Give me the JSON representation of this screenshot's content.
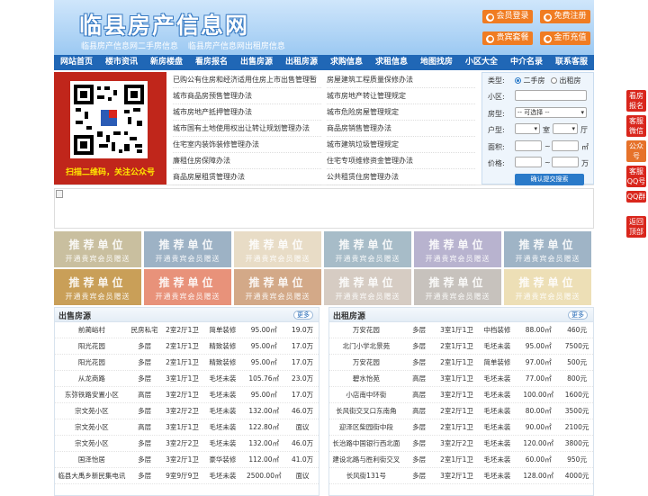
{
  "header": {
    "logo": "临县房产信息网",
    "sub_links": [
      "临县房产信息网二手房信息",
      "临县房产信息网出租房信息"
    ],
    "buttons": [
      {
        "label": "会员登录",
        "icon": "user-icon"
      },
      {
        "label": "免费注册",
        "icon": "register-icon"
      },
      {
        "label": "贵宾套餐",
        "icon": "vip-icon"
      },
      {
        "label": "金币充值",
        "icon": "coin-icon"
      }
    ]
  },
  "nav": [
    "网站首页",
    "楼市资讯",
    "新房楼盘",
    "看房报名",
    "出售房源",
    "出租房源",
    "求购信息",
    "求租信息",
    "地图找房",
    "小区大全",
    "中介名录",
    "联系客服"
  ],
  "qr_caption": "扫描二维码，关注公众号",
  "news_left": [
    "已购公有住房和经济适用住房上市出售管理暂",
    "城市商品房预售管理办法",
    "城市房地产抵押管理办法",
    "城市国有土地使用权出让转让规划管理办法",
    "住宅室内装饰装修管理办法",
    "廉租住房保障办法",
    "商品房屋租赁管理办法"
  ],
  "news_right": [
    "房屋建筑工程质量保修办法",
    "城市房地产转让管理规定",
    "城市危险房屋管理规定",
    "商品房销售管理办法",
    "城市建筑垃圾管理规定",
    "住宅专项维修资金管理办法",
    "公共租赁住房管理办法"
  ],
  "search": {
    "type_label": "类型:",
    "opt1": "二手房",
    "opt2": "出租房",
    "community_label": "小区:",
    "house_type_label": "房型:",
    "house_type_select": "-- 可选择 --",
    "layout_label": "户型:",
    "room_unit": "室",
    "hall_unit": "厅",
    "area_label": "面积:",
    "area_tilde": "~",
    "area_unit": "㎡",
    "price_label": "价格:",
    "price_tilde": "~",
    "price_unit": "万",
    "submit": "确认提交搜索"
  },
  "tiles": {
    "title": "推荐单位",
    "caption": "开通贵宾会员赠送",
    "colors": [
      "#c9bf9f",
      "#9db2c5",
      "#e8dcc6",
      "#a7bcc8",
      "#b8b3cf",
      "#9fb4c6",
      "#c99f58",
      "#e8927a",
      "#d3a988",
      "#d6ccc3",
      "#c7c2bd",
      "#eddfb6"
    ]
  },
  "sale": {
    "title": "出售房源",
    "more": "更多",
    "rows": [
      [
        "前蔺峪村",
        "民房私宅",
        "2室2厅1卫",
        "简单装修",
        "95.00㎡",
        "19.0万"
      ],
      [
        "阳光花园",
        "多层",
        "2室1厅1卫",
        "精致装修",
        "95.00㎡",
        "17.0万"
      ],
      [
        "阳光花园",
        "多层",
        "2室1厅1卫",
        "精致装修",
        "95.00㎡",
        "17.0万"
      ],
      [
        "从龙商路",
        "多层",
        "3室1厅1卫",
        "毛坯未装",
        "105.76㎡",
        "23.0万"
      ],
      [
        "东弥铁路安置小区",
        "高层",
        "3室2厅1卫",
        "毛坯未装",
        "95.00㎡",
        "17.0万"
      ],
      [
        "宗文苑小区",
        "多层",
        "3室2厅2卫",
        "毛坯未装",
        "132.00㎡",
        "46.0万"
      ],
      [
        "宗文苑小区",
        "高层",
        "3室1厅1卫",
        "毛坯未装",
        "122.80㎡",
        "面议"
      ],
      [
        "宗文苑小区",
        "多层",
        "3室2厅2卫",
        "毛坯未装",
        "132.00㎡",
        "46.0万"
      ],
      [
        "国泽怡居",
        "多层",
        "3室2厅1卫",
        "豪华装修",
        "112.00㎡",
        "41.0万"
      ],
      [
        "临县大禹乡新民集电讯",
        "多层",
        "9室9厅9卫",
        "毛坯未装",
        "2500.00㎡",
        "面议"
      ]
    ]
  },
  "rent": {
    "title": "出租房源",
    "more": "更多",
    "rows": [
      [
        "万安花园",
        "多层",
        "3室1厅1卫",
        "中档装修",
        "88.00㎡",
        "460元"
      ],
      [
        "北门小学北景苑",
        "多层",
        "2室1厅1卫",
        "毛坯未装",
        "95.00㎡",
        "7500元"
      ],
      [
        "万安花园",
        "多层",
        "2室1厅1卫",
        "简单装修",
        "97.00㎡",
        "500元"
      ],
      [
        "碧水怡苑",
        "高层",
        "3室1厅1卫",
        "毛坯未装",
        "77.00㎡",
        "800元"
      ],
      [
        "小店南中环街",
        "高层",
        "3室2厅1卫",
        "毛坯未装",
        "100.00㎡",
        "1600元"
      ],
      [
        "长风街交叉口东南角",
        "高层",
        "2室2厅1卫",
        "毛坯未装",
        "80.00㎡",
        "3500元"
      ],
      [
        "迎泽区柴园街中段",
        "多层",
        "2室1厅1卫",
        "毛坯未装",
        "90.00㎡",
        "2100元"
      ],
      [
        "长治路中国银行西北面",
        "多层",
        "3室2厅2卫",
        "毛坯未装",
        "120.00㎡",
        "3800元"
      ],
      [
        "建设北路与胜利街交叉",
        "多层",
        "2室1厅1卫",
        "毛坯未装",
        "60.00㎡",
        "950元"
      ],
      [
        "长风街131号",
        "多层",
        "3室2厅1卫",
        "毛坯未装",
        "128.00㎡",
        "4000元"
      ]
    ]
  },
  "float": [
    "看房报名",
    "客服微信",
    "公众号",
    "客服QQ号",
    "QQ群",
    "返回顶部"
  ]
}
